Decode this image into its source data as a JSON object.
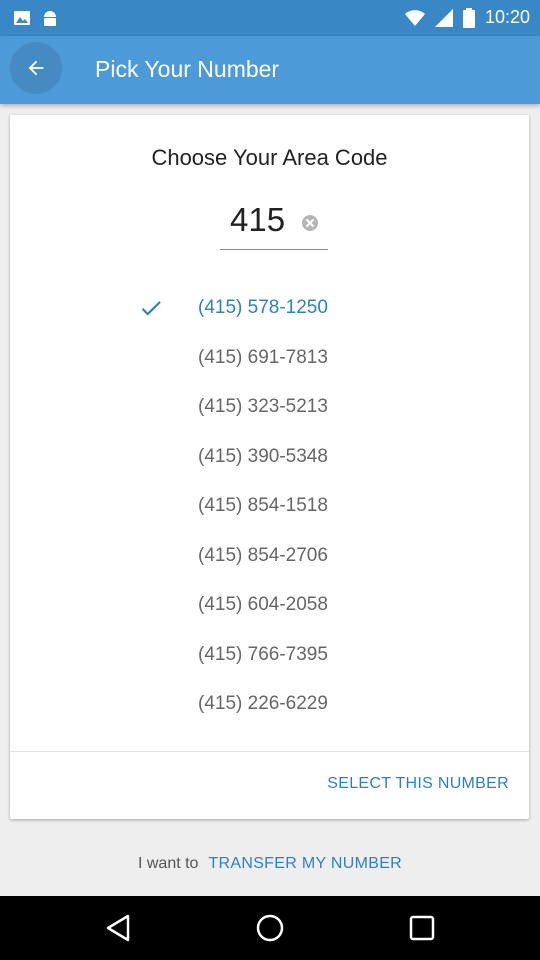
{
  "status_bar": {
    "time": "10:20"
  },
  "header": {
    "title": "Pick Your Number"
  },
  "card": {
    "heading": "Choose Your Area Code",
    "area_code": "415",
    "numbers": [
      "(415) 578-1250",
      "(415) 691-7813",
      "(415) 323-5213",
      "(415) 390-5348",
      "(415) 854-1518",
      "(415) 854-2706",
      "(415) 604-2058",
      "(415) 766-7395",
      "(415) 226-6229"
    ],
    "selected_index": 0,
    "select_label": "SELECT THIS NUMBER"
  },
  "footer": {
    "prefix": "I want to",
    "link": "TRANSFER MY NUMBER"
  },
  "colors": {
    "status_bar": "#3a87c6",
    "app_bar": "#4d9ad8",
    "accent": "#2f7fc5"
  }
}
